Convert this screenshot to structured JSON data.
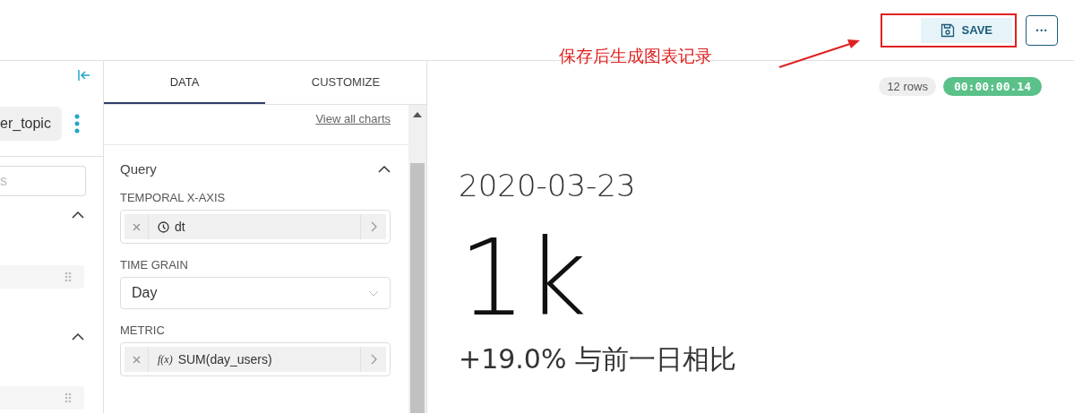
{
  "header": {
    "save_label": "SAVE",
    "more_label": "···"
  },
  "annotation": {
    "text": "保存后生成图表记录"
  },
  "datasource": {
    "name": "er_topic",
    "search_placeholder": "s"
  },
  "tabs": [
    {
      "label": "DATA",
      "selected": true
    },
    {
      "label": "CUSTOMIZE",
      "selected": false
    }
  ],
  "view_all": "View all charts",
  "query": {
    "title": "Query",
    "expanded": true,
    "controls": [
      {
        "kind": "column",
        "label": "TEMPORAL X-AXIS",
        "value": "dt"
      },
      {
        "kind": "select",
        "label": "TIME GRAIN",
        "value": "Day"
      },
      {
        "kind": "metric",
        "label": "METRIC",
        "value": "SUM(day_users)",
        "icon_text": "f(x)"
      }
    ]
  },
  "result": {
    "rows": "12 rows",
    "duration": "00:00:00.14"
  },
  "bignumber": {
    "date": "2020-03-23",
    "value": "1k",
    "comparison": "+19.0% 与前一日相比"
  }
}
